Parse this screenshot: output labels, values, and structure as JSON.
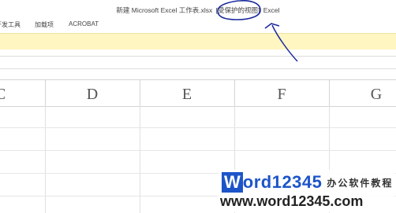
{
  "window": {
    "title_prefix": "新建 Microsoft Excel 工作表.xlsx",
    "protected_view": "[受保护的视图]",
    "app_name": "Excel"
  },
  "ribbon": {
    "tabs": [
      {
        "label": "开发工具"
      },
      {
        "label": "加载项"
      },
      {
        "label": "ACROBAT"
      }
    ]
  },
  "sheet": {
    "columns": [
      "D",
      "E",
      "F",
      "G"
    ],
    "partial_left_column": "C"
  },
  "watermark": {
    "brand_letter": "W",
    "brand_rest": "ord12345",
    "tagline": "办公软件教程",
    "url": "www.word12345.com"
  },
  "colors": {
    "infobar": "#fff6c2",
    "annotation_ink": "#1a2a9c",
    "brand_blue": "#1d55c9"
  }
}
